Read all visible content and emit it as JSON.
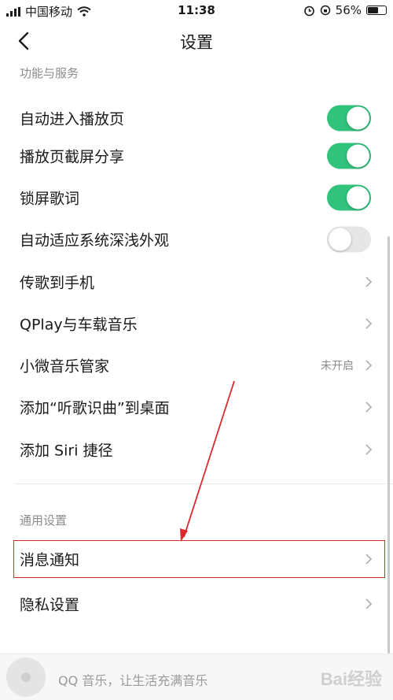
{
  "status_bar": {
    "carrier": "中国移动",
    "time": "11:38",
    "battery": "56%"
  },
  "header": {
    "title": "设置"
  },
  "sections": {
    "features": {
      "label": "功能与服务",
      "items": [
        {
          "label": "自动进入播放页",
          "toggle": true
        },
        {
          "label": "播放页截屏分享",
          "toggle": true
        },
        {
          "label": "锁屏歌词",
          "toggle": true
        },
        {
          "label": "自动适应系统深浅外观",
          "toggle": false
        },
        {
          "label": "传歌到手机"
        },
        {
          "label": "QPlay与车载音乐"
        },
        {
          "label": "小微音乐管家",
          "value": "未开启"
        },
        {
          "label": "添加“听歌识曲”到桌面"
        },
        {
          "label": "添加 Siri 捷径"
        }
      ]
    },
    "general": {
      "label": "通用设置",
      "items": [
        {
          "label": "消息通知"
        },
        {
          "label": "隐私设置"
        }
      ]
    }
  },
  "player": {
    "slogan": "QQ 音乐，让生活充满音乐",
    "watermark": "Bai经验"
  },
  "colors": {
    "accent": "#31c27c",
    "highlight": "#d92b2b"
  }
}
